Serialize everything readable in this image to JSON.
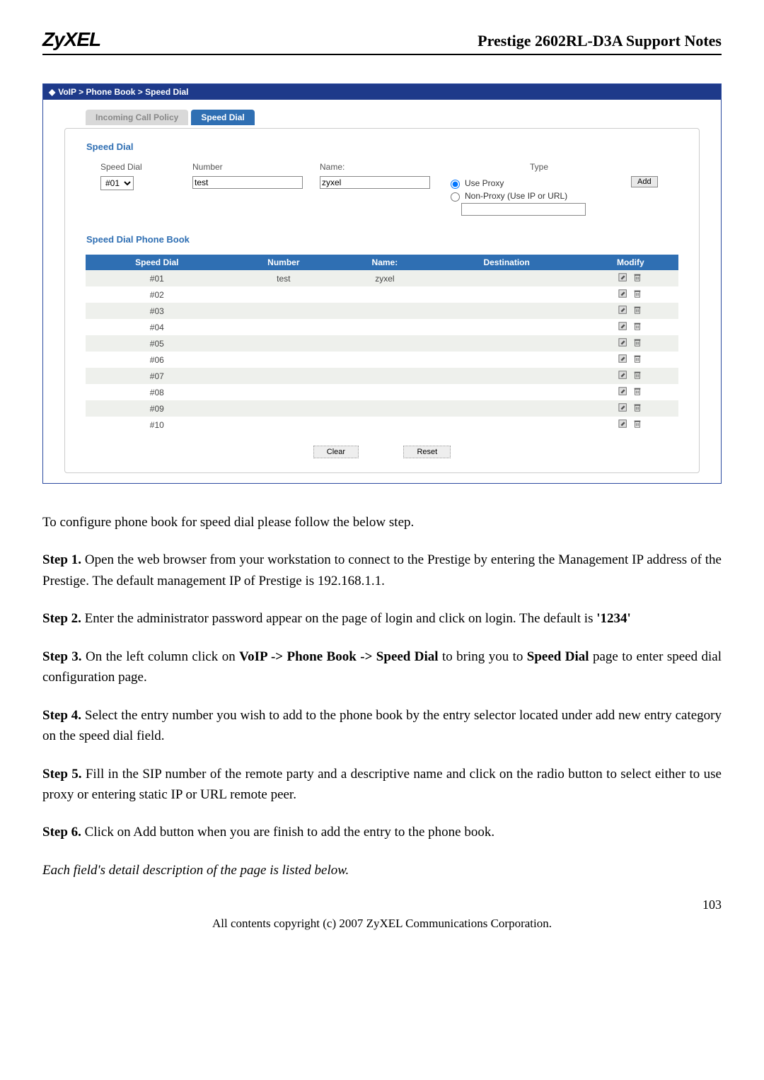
{
  "header": {
    "logo": "ZyXEL",
    "title": "Prestige 2602RL-D3A Support Notes"
  },
  "screenshot": {
    "breadcrumb": "VoIP > Phone Book > Speed Dial",
    "tabs": {
      "inactive": "Incoming Call Policy",
      "active": "Speed Dial"
    },
    "section1_title": "Speed Dial",
    "entry": {
      "headers": {
        "speed": "Speed Dial",
        "number": "Number",
        "name": "Name:",
        "type": "Type"
      },
      "speed_value": "#01",
      "number_value": "test",
      "name_value": "zyxel",
      "type_proxy": "Use Proxy",
      "type_nonproxy": "Non-Proxy (Use IP or URL)",
      "add_btn": "Add"
    },
    "section2_title": "Speed Dial Phone Book",
    "table": {
      "cols": {
        "speed": "Speed Dial",
        "number": "Number",
        "name": "Name:",
        "dest": "Destination",
        "modify": "Modify"
      },
      "rows": [
        {
          "id": "#01",
          "number": "test",
          "name": "zyxel",
          "dest": ""
        },
        {
          "id": "#02",
          "number": "",
          "name": "",
          "dest": ""
        },
        {
          "id": "#03",
          "number": "",
          "name": "",
          "dest": ""
        },
        {
          "id": "#04",
          "number": "",
          "name": "",
          "dest": ""
        },
        {
          "id": "#05",
          "number": "",
          "name": "",
          "dest": ""
        },
        {
          "id": "#06",
          "number": "",
          "name": "",
          "dest": ""
        },
        {
          "id": "#07",
          "number": "",
          "name": "",
          "dest": ""
        },
        {
          "id": "#08",
          "number": "",
          "name": "",
          "dest": ""
        },
        {
          "id": "#09",
          "number": "",
          "name": "",
          "dest": ""
        },
        {
          "id": "#10",
          "number": "",
          "name": "",
          "dest": ""
        }
      ]
    },
    "clear_btn": "Clear",
    "reset_btn": "Reset"
  },
  "body": {
    "intro": "To configure phone book for speed dial please follow the below step.",
    "step1_label": "Step 1.",
    "step1_text": " Open the web browser from your workstation to connect to the Prestige by entering the Management IP address of the Prestige.  The default management IP of Prestige is 192.168.1.1.",
    "step2_label": "Step 2.",
    "step2_text_a": " Enter the administrator password appear on the page of login and click on login. The default is ",
    "step2_text_b": "'1234'",
    "step3_label": "Step 3.",
    "step3_text_a": " On the left column click on ",
    "step3_text_b": "VoIP -> Phone Book -> Speed Dial",
    "step3_text_c": " to bring you to ",
    "step3_text_d": "Speed Dial",
    "step3_text_e": " page to enter speed dial configuration page.",
    "step4_label": "Step 4.",
    "step4_text": " Select the entry number you wish to add to the phone book by the entry selector located under add new entry category on the speed dial field.",
    "step5_label": "Step 5.",
    "step5_text": " Fill in the SIP number of the remote party and a descriptive name and click on the radio button to select either to use proxy or entering static IP or URL remote peer.",
    "step6_label": "Step 6.",
    "step6_text": "  Click on Add button when you are finish to add the entry to the phone book.",
    "closing": "Each field's detail description of the page is listed below."
  },
  "page_num": "103",
  "footer": "All contents copyright (c) 2007 ZyXEL Communications Corporation."
}
